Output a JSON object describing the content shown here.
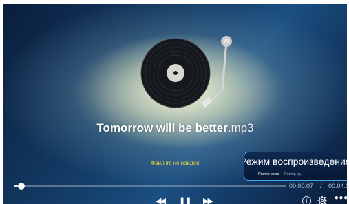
{
  "player": {
    "track_name": "Tomorrow will be better",
    "track_ext": ".mp3",
    "lyrics_status": "Файл lrc не найден.",
    "playback_mode": {
      "title": "Режим воспроизведения",
      "options": [
        "Повтор всего",
        "Повтор од"
      ]
    },
    "progress": {
      "current_time": "00:00:07",
      "separator": "/",
      "total_time": "00:04:3",
      "fraction": 0.025
    },
    "controls": {
      "rewind_icon": "rewind-icon",
      "pause_icon": "pause-icon",
      "fast_forward_icon": "fast-forward-icon",
      "info_icon": "info-icon",
      "settings_icon": "gear-icon",
      "more_icon": "more-icon"
    },
    "colors": {
      "accent": "#3ea8ee",
      "lyrics_text": "#e6d23c"
    }
  }
}
